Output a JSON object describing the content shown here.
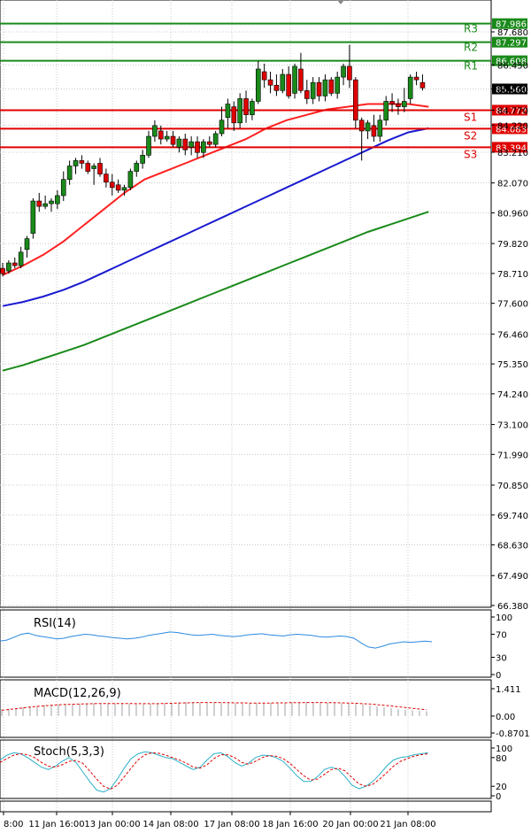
{
  "chart_data": {
    "type": "candlestick",
    "price_axis": {
      "ticks": [
        "87.680",
        "86.450",
        "85.560",
        "84.770",
        "84.220",
        "83.210",
        "82.070",
        "80.960",
        "79.820",
        "78.710",
        "77.600",
        "76.460",
        "75.350",
        "74.240",
        "73.100",
        "71.990",
        "70.850",
        "69.740",
        "68.630",
        "67.490",
        "66.380"
      ],
      "ylim": [
        66.38,
        88.6
      ]
    },
    "time_axis": {
      "labels": [
        "8:00",
        "11 Jan 16:00",
        "13 Jan 00:00",
        "14 Jan 08:00",
        "17 Jan 08:00",
        "18 Jan 16:00",
        "20 Jan 00:00",
        "21 Jan 08:00"
      ]
    },
    "current_price": 85.56,
    "pivot_levels": [
      {
        "name": "R3",
        "value": 87.986,
        "tag": "87.986",
        "color": "#1a8a1a"
      },
      {
        "name": "R2",
        "value": 87.297,
        "tag": "87.297",
        "color": "#1a8a1a"
      },
      {
        "name": "R1",
        "value": 86.608,
        "tag": "86.608",
        "color": "#1a8a1a"
      },
      {
        "name": "S1",
        "value": 84.772,
        "tag": "84.772",
        "color": "#e00000"
      },
      {
        "name": "S2",
        "value": 84.083,
        "tag": "84.083",
        "color": "#e00000"
      },
      {
        "name": "S3",
        "value": 83.394,
        "tag": "83.394",
        "color": "#e00000"
      }
    ],
    "candles": [
      {
        "o": 78.9,
        "h": 79.1,
        "l": 78.6,
        "c": 78.7
      },
      {
        "o": 78.8,
        "h": 79.2,
        "l": 78.7,
        "c": 79.1
      },
      {
        "o": 79.1,
        "h": 79.3,
        "l": 78.9,
        "c": 79.0
      },
      {
        "o": 79.0,
        "h": 79.7,
        "l": 78.9,
        "c": 79.5
      },
      {
        "o": 79.6,
        "h": 80.1,
        "l": 79.3,
        "c": 80.0
      },
      {
        "o": 80.2,
        "h": 81.5,
        "l": 80.0,
        "c": 81.4
      },
      {
        "o": 81.4,
        "h": 81.7,
        "l": 81.0,
        "c": 81.2
      },
      {
        "o": 81.2,
        "h": 81.6,
        "l": 81.1,
        "c": 81.3
      },
      {
        "o": 81.3,
        "h": 81.5,
        "l": 81.0,
        "c": 81.4
      },
      {
        "o": 81.3,
        "h": 81.8,
        "l": 81.1,
        "c": 81.6
      },
      {
        "o": 81.6,
        "h": 82.5,
        "l": 81.4,
        "c": 82.2
      },
      {
        "o": 82.2,
        "h": 82.9,
        "l": 82.0,
        "c": 82.7
      },
      {
        "o": 82.7,
        "h": 83.0,
        "l": 82.4,
        "c": 82.9
      },
      {
        "o": 82.9,
        "h": 83.1,
        "l": 82.6,
        "c": 82.8
      },
      {
        "o": 82.8,
        "h": 82.9,
        "l": 82.4,
        "c": 82.5
      },
      {
        "o": 82.6,
        "h": 82.8,
        "l": 82.0,
        "c": 82.7
      },
      {
        "o": 82.8,
        "h": 83.0,
        "l": 82.3,
        "c": 82.4
      },
      {
        "o": 82.4,
        "h": 82.6,
        "l": 81.9,
        "c": 82.1
      },
      {
        "o": 82.1,
        "h": 82.4,
        "l": 81.6,
        "c": 81.9
      },
      {
        "o": 82.0,
        "h": 82.2,
        "l": 81.7,
        "c": 81.8
      },
      {
        "o": 81.8,
        "h": 82.0,
        "l": 81.6,
        "c": 81.9
      },
      {
        "o": 81.9,
        "h": 82.6,
        "l": 81.8,
        "c": 82.5
      },
      {
        "o": 82.5,
        "h": 82.9,
        "l": 82.3,
        "c": 82.8
      },
      {
        "o": 82.8,
        "h": 83.3,
        "l": 82.6,
        "c": 83.1
      },
      {
        "o": 83.1,
        "h": 84.0,
        "l": 83.0,
        "c": 83.8
      },
      {
        "o": 83.8,
        "h": 84.4,
        "l": 83.6,
        "c": 84.2
      },
      {
        "o": 84.0,
        "h": 84.2,
        "l": 83.5,
        "c": 83.7
      },
      {
        "o": 83.7,
        "h": 84.0,
        "l": 83.6,
        "c": 83.8
      },
      {
        "o": 83.8,
        "h": 84.0,
        "l": 83.4,
        "c": 83.5
      },
      {
        "o": 83.4,
        "h": 83.8,
        "l": 83.2,
        "c": 83.7
      },
      {
        "o": 83.7,
        "h": 83.9,
        "l": 83.1,
        "c": 83.3
      },
      {
        "o": 83.4,
        "h": 83.8,
        "l": 83.1,
        "c": 83.6
      },
      {
        "o": 83.6,
        "h": 83.8,
        "l": 83.0,
        "c": 83.2
      },
      {
        "o": 83.2,
        "h": 83.7,
        "l": 83.0,
        "c": 83.6
      },
      {
        "o": 83.6,
        "h": 83.8,
        "l": 83.4,
        "c": 83.5
      },
      {
        "o": 83.5,
        "h": 84.0,
        "l": 83.4,
        "c": 83.9
      },
      {
        "o": 83.9,
        "h": 84.9,
        "l": 83.8,
        "c": 84.4
      },
      {
        "o": 84.5,
        "h": 85.2,
        "l": 84.1,
        "c": 85.0
      },
      {
        "o": 84.9,
        "h": 85.1,
        "l": 84.0,
        "c": 84.3
      },
      {
        "o": 84.3,
        "h": 85.4,
        "l": 84.1,
        "c": 85.2
      },
      {
        "o": 85.2,
        "h": 85.5,
        "l": 84.3,
        "c": 84.6
      },
      {
        "o": 84.6,
        "h": 85.2,
        "l": 84.4,
        "c": 85.1
      },
      {
        "o": 85.1,
        "h": 86.6,
        "l": 85.0,
        "c": 86.3
      },
      {
        "o": 86.2,
        "h": 86.5,
        "l": 85.6,
        "c": 85.9
      },
      {
        "o": 85.9,
        "h": 86.2,
        "l": 85.4,
        "c": 85.7
      },
      {
        "o": 85.7,
        "h": 86.1,
        "l": 85.3,
        "c": 85.5
      },
      {
        "o": 85.5,
        "h": 86.3,
        "l": 85.4,
        "c": 86.1
      },
      {
        "o": 86.1,
        "h": 86.4,
        "l": 85.2,
        "c": 85.3
      },
      {
        "o": 85.4,
        "h": 86.5,
        "l": 85.2,
        "c": 86.4
      },
      {
        "o": 86.3,
        "h": 86.9,
        "l": 85.4,
        "c": 85.5
      },
      {
        "o": 85.5,
        "h": 85.9,
        "l": 85.0,
        "c": 85.2
      },
      {
        "o": 85.2,
        "h": 86.0,
        "l": 85.0,
        "c": 85.8
      },
      {
        "o": 85.8,
        "h": 86.0,
        "l": 85.1,
        "c": 85.3
      },
      {
        "o": 85.3,
        "h": 86.1,
        "l": 85.1,
        "c": 85.9
      },
      {
        "o": 85.9,
        "h": 86.0,
        "l": 85.3,
        "c": 85.4
      },
      {
        "o": 85.4,
        "h": 86.2,
        "l": 85.2,
        "c": 86.0
      },
      {
        "o": 86.0,
        "h": 86.5,
        "l": 85.7,
        "c": 86.4
      },
      {
        "o": 86.4,
        "h": 87.2,
        "l": 85.6,
        "c": 85.9
      },
      {
        "o": 85.9,
        "h": 86.0,
        "l": 84.1,
        "c": 84.4
      },
      {
        "o": 84.4,
        "h": 84.5,
        "l": 82.9,
        "c": 84.0
      },
      {
        "o": 84.0,
        "h": 84.4,
        "l": 83.7,
        "c": 84.3
      },
      {
        "o": 84.2,
        "h": 84.6,
        "l": 83.6,
        "c": 83.8
      },
      {
        "o": 83.8,
        "h": 84.6,
        "l": 83.6,
        "c": 84.4
      },
      {
        "o": 84.4,
        "h": 85.3,
        "l": 84.2,
        "c": 85.1
      },
      {
        "o": 85.1,
        "h": 85.4,
        "l": 84.7,
        "c": 85.0
      },
      {
        "o": 85.0,
        "h": 85.2,
        "l": 84.6,
        "c": 84.9
      },
      {
        "o": 84.9,
        "h": 85.6,
        "l": 84.7,
        "c": 85.1
      },
      {
        "o": 85.2,
        "h": 86.1,
        "l": 85.0,
        "c": 86.0
      },
      {
        "o": 86.0,
        "h": 86.2,
        "l": 85.7,
        "c": 85.9
      },
      {
        "o": 85.8,
        "h": 86.1,
        "l": 85.5,
        "c": 85.6
      }
    ],
    "moving_averages": [
      {
        "period": "short",
        "color": "#ff2020",
        "values": [
          [
            0,
            78.65
          ],
          [
            6,
            79.0
          ],
          [
            12,
            79.4
          ],
          [
            18,
            79.9
          ],
          [
            24,
            80.5
          ],
          [
            30,
            81.1
          ],
          [
            36,
            81.7
          ],
          [
            42,
            82.2
          ],
          [
            48,
            82.5
          ],
          [
            54,
            82.8
          ],
          [
            60,
            83.1
          ],
          [
            66,
            83.4
          ],
          [
            72,
            83.7
          ],
          [
            78,
            84.1
          ],
          [
            84,
            84.4
          ],
          [
            90,
            84.6
          ],
          [
            96,
            84.8
          ],
          [
            102,
            84.9
          ],
          [
            108,
            85.0
          ],
          [
            114,
            85.0
          ],
          [
            120,
            85.0
          ],
          [
            126,
            84.9
          ]
        ]
      },
      {
        "period": "medium",
        "color": "#1a1ad0",
        "values": [
          [
            0,
            77.5
          ],
          [
            6,
            77.65
          ],
          [
            12,
            77.85
          ],
          [
            18,
            78.1
          ],
          [
            24,
            78.4
          ],
          [
            30,
            78.75
          ],
          [
            36,
            79.1
          ],
          [
            42,
            79.45
          ],
          [
            48,
            79.8
          ],
          [
            54,
            80.15
          ],
          [
            60,
            80.5
          ],
          [
            66,
            80.85
          ],
          [
            72,
            81.2
          ],
          [
            78,
            81.55
          ],
          [
            84,
            81.9
          ],
          [
            90,
            82.25
          ],
          [
            96,
            82.6
          ],
          [
            102,
            82.95
          ],
          [
            108,
            83.3
          ],
          [
            114,
            83.65
          ],
          [
            120,
            83.95
          ],
          [
            126,
            84.1
          ]
        ]
      },
      {
        "period": "long",
        "color": "#1a8a1a",
        "values": [
          [
            0,
            75.1
          ],
          [
            6,
            75.3
          ],
          [
            12,
            75.55
          ],
          [
            18,
            75.8
          ],
          [
            24,
            76.05
          ],
          [
            30,
            76.35
          ],
          [
            36,
            76.65
          ],
          [
            42,
            76.95
          ],
          [
            48,
            77.25
          ],
          [
            54,
            77.55
          ],
          [
            60,
            77.85
          ],
          [
            66,
            78.15
          ],
          [
            72,
            78.45
          ],
          [
            78,
            78.75
          ],
          [
            84,
            79.05
          ],
          [
            90,
            79.35
          ],
          [
            96,
            79.65
          ],
          [
            102,
            79.95
          ],
          [
            108,
            80.25
          ],
          [
            114,
            80.5
          ],
          [
            120,
            80.75
          ],
          [
            126,
            81.0
          ]
        ]
      }
    ],
    "rsi": {
      "label": "RSI(14)",
      "ticks": [
        "100",
        "70",
        "30",
        "0"
      ],
      "ylim": [
        0,
        100
      ],
      "values": [
        58,
        60,
        65,
        70,
        72,
        68,
        66,
        64,
        62,
        63,
        66,
        68,
        70,
        69,
        67,
        66,
        64,
        63,
        62,
        63,
        65,
        68,
        70,
        72,
        74,
        73,
        71,
        69,
        68,
        69,
        70,
        68,
        67,
        66,
        67,
        69,
        70,
        71,
        69,
        68,
        67,
        69,
        70,
        69,
        68,
        66,
        65,
        66,
        67,
        66,
        63,
        55,
        48,
        46,
        49,
        53,
        55,
        57,
        56,
        57,
        58,
        57
      ]
    },
    "macd": {
      "label": "MACD(12,26,9)",
      "ticks": [
        "1.411",
        "0.00",
        "-0.8701"
      ],
      "ylim": [
        -0.8701,
        1.411
      ],
      "histogram": [
        0.35,
        0.38,
        0.42,
        0.46,
        0.5,
        0.53,
        0.56,
        0.58,
        0.6,
        0.62,
        0.63,
        0.64,
        0.65,
        0.66,
        0.66,
        0.66,
        0.65,
        0.64,
        0.63,
        0.62,
        0.62,
        0.63,
        0.64,
        0.66,
        0.68,
        0.7,
        0.71,
        0.71,
        0.7,
        0.69,
        0.68,
        0.67,
        0.66,
        0.65,
        0.65,
        0.65,
        0.66,
        0.67,
        0.68,
        0.69,
        0.7,
        0.7,
        0.71,
        0.71,
        0.7,
        0.69,
        0.68,
        0.67,
        0.66,
        0.65,
        0.63,
        0.6,
        0.55,
        0.5,
        0.45,
        0.41,
        0.37,
        0.33,
        0.3,
        0.27,
        0.25
      ],
      "signal": [
        0.3,
        0.34,
        0.38,
        0.42,
        0.46,
        0.5,
        0.53,
        0.56,
        0.58,
        0.6,
        0.61,
        0.62,
        0.63,
        0.64,
        0.65,
        0.65,
        0.65,
        0.65,
        0.65,
        0.64,
        0.64,
        0.64,
        0.64,
        0.65,
        0.66,
        0.67,
        0.68,
        0.69,
        0.7,
        0.7,
        0.7,
        0.7,
        0.69,
        0.68,
        0.68,
        0.67,
        0.67,
        0.67,
        0.67,
        0.68,
        0.68,
        0.69,
        0.69,
        0.7,
        0.7,
        0.7,
        0.69,
        0.69,
        0.68,
        0.67,
        0.66,
        0.64,
        0.62,
        0.59,
        0.56,
        0.52,
        0.48,
        0.44,
        0.4,
        0.36,
        0.33
      ]
    },
    "stoch": {
      "label": "Stoch(5,3,3)",
      "ticks": [
        "100",
        "80",
        "20",
        "0"
      ],
      "ylim": [
        0,
        100
      ],
      "k": [
        75,
        85,
        90,
        88,
        80,
        70,
        60,
        55,
        62,
        72,
        80,
        70,
        50,
        30,
        12,
        8,
        15,
        35,
        58,
        78,
        88,
        92,
        90,
        85,
        80,
        78,
        70,
        62,
        55,
        60,
        75,
        88,
        90,
        82,
        70,
        62,
        68,
        80,
        85,
        84,
        80,
        72,
        58,
        42,
        30,
        30,
        40,
        55,
        60,
        55,
        40,
        22,
        15,
        20,
        30,
        45,
        62,
        75,
        80,
        82,
        86,
        88,
        90
      ],
      "d": [
        70,
        78,
        85,
        88,
        86,
        80,
        70,
        62,
        60,
        65,
        72,
        74,
        68,
        52,
        35,
        20,
        14,
        22,
        40,
        58,
        75,
        86,
        90,
        89,
        85,
        80,
        75,
        68,
        60,
        58,
        65,
        78,
        86,
        86,
        80,
        70,
        66,
        72,
        80,
        84,
        83,
        78,
        68,
        55,
        42,
        33,
        35,
        45,
        55,
        58,
        52,
        38,
        25,
        20,
        24,
        35,
        48,
        62,
        72,
        78,
        83,
        86,
        88
      ]
    }
  }
}
